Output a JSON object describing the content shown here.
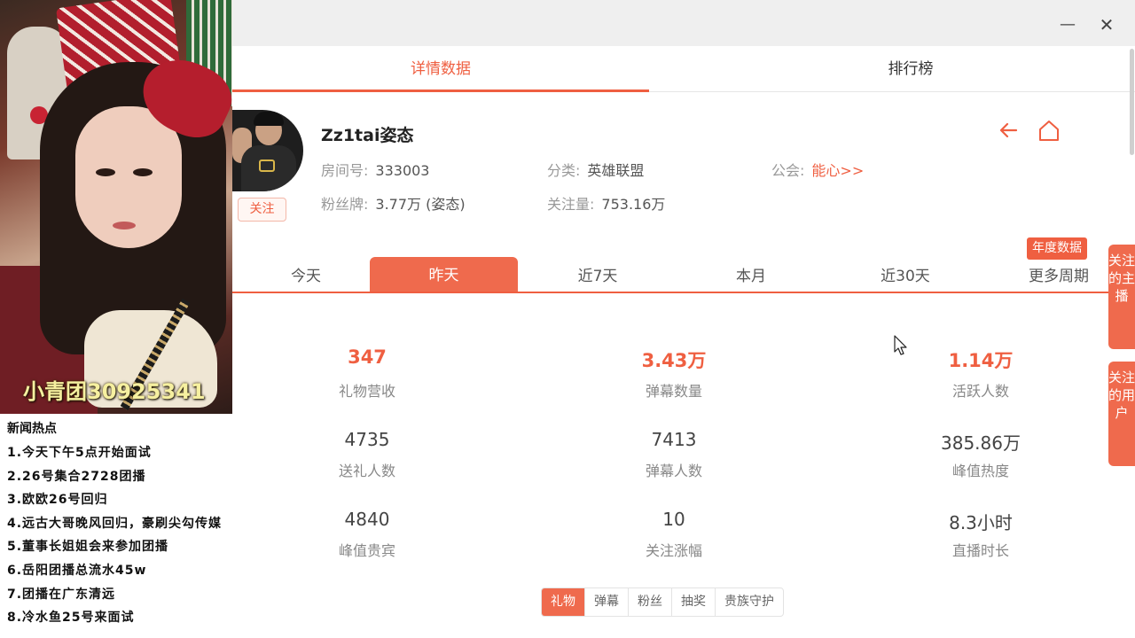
{
  "video": {
    "caption": "小青团30925341"
  },
  "news": {
    "title": "新闻热点",
    "items": [
      "1.今天下午5点开始面试",
      "2.26号集合2728团播",
      "3.欧欧26号回归",
      "4.远古大哥晚风回归，豪刷尖勾传媒",
      "5.董事长姐姐会来参加团播",
      "6.岳阳团播总流水45w",
      "7.团播在广东清远",
      "8.冷水鱼25号来面试"
    ]
  },
  "window": {
    "minimize": "—",
    "close": "✕"
  },
  "tabs": [
    {
      "label": "详情数据",
      "active": true
    },
    {
      "label": "排行榜",
      "active": false
    }
  ],
  "streamer": {
    "name": "Zz1tai姿态",
    "follow_label": "关注",
    "room_label": "房间号:",
    "room_value": "333003",
    "category_label": "分类:",
    "category_value": "英雄联盟",
    "guild_label": "公会:",
    "guild_value": "能心>>",
    "fanbadge_label": "粉丝牌:",
    "fanbadge_value": "3.77万 (姿态)",
    "followers_label": "关注量:",
    "followers_value": "753.16万"
  },
  "icons": {
    "back": "back-arrow-icon",
    "home": "home-icon"
  },
  "annual_badge": "年度数据",
  "periods": [
    "今天",
    "昨天",
    "近7天",
    "本月",
    "近30天",
    "更多周期"
  ],
  "active_period": "昨天",
  "stats": [
    {
      "value": "347",
      "label": "礼物营收",
      "highlight": true
    },
    {
      "value": "3.43万",
      "label": "弹幕数量",
      "highlight": true
    },
    {
      "value": "1.14万",
      "label": "活跃人数",
      "highlight": true
    },
    {
      "value": "4735",
      "label": "送礼人数",
      "highlight": false
    },
    {
      "value": "7413",
      "label": "弹幕人数",
      "highlight": false
    },
    {
      "value": "385.86万",
      "label": "峰值热度",
      "highlight": false
    },
    {
      "value": "4840",
      "label": "峰值贵宾",
      "highlight": false
    },
    {
      "value": "10",
      "label": "关注涨幅",
      "highlight": false
    },
    {
      "value": "8.3小时",
      "label": "直播时长",
      "highlight": false
    }
  ],
  "side_tabs": [
    "关注的主播",
    "关注的用户"
  ],
  "subtabs": [
    "礼物",
    "弹幕",
    "粉丝",
    "抽奖",
    "贵族守护"
  ],
  "active_subtab": "礼物",
  "colors": {
    "accent": "#ef5f41"
  }
}
